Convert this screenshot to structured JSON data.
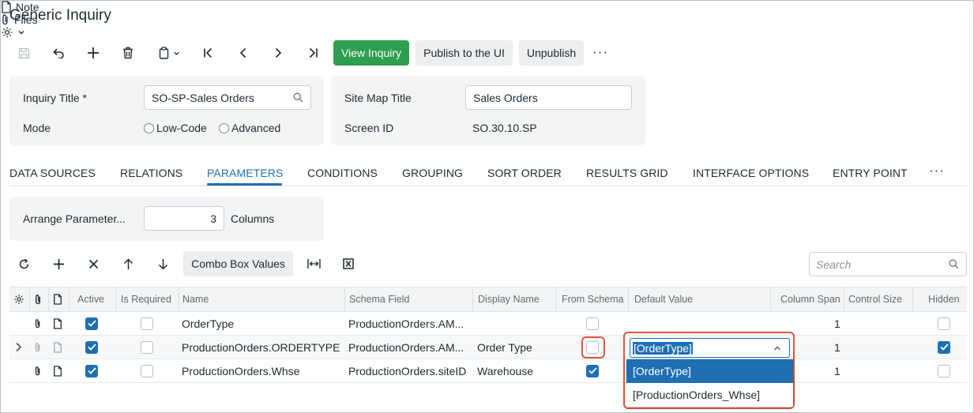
{
  "page": {
    "title": "Generic Inquiry",
    "actions": {
      "note": "Note",
      "files": "Files"
    }
  },
  "toolbar": {
    "view_inquiry": "View Inquiry",
    "publish": "Publish to the UI",
    "unpublish": "Unpublish",
    "more": "···"
  },
  "form": {
    "inquiry_title_label": "Inquiry Title *",
    "inquiry_title_value": "SO-SP-Sales Orders",
    "mode_label": "Mode",
    "mode_options": [
      "Low-Code",
      "Advanced"
    ],
    "site_map_title_label": "Site Map Title",
    "site_map_title_value": "Sales Orders",
    "screen_id_label": "Screen ID",
    "screen_id_value": "SO.30.10.SP"
  },
  "tabs": [
    "DATA SOURCES",
    "RELATIONS",
    "PARAMETERS",
    "CONDITIONS",
    "GROUPING",
    "SORT ORDER",
    "RESULTS GRID",
    "INTERFACE OPTIONS",
    "ENTRY POINT"
  ],
  "tabs_more": "···",
  "active_tab": "PARAMETERS",
  "arrange": {
    "label": "Arrange Parameter...",
    "value": "3",
    "suffix": "Columns"
  },
  "grid": {
    "combo_box_values": "Combo Box Values",
    "search_placeholder": "Search",
    "columns": [
      "Active",
      "Is Required",
      "Name",
      "Schema Field",
      "Display Name",
      "From Schema",
      "Default Value",
      "Column Span",
      "Control Size",
      "Hidden"
    ],
    "rows": [
      {
        "active": true,
        "is_required": false,
        "name": "OrderType",
        "schema_field": "ProductionOrders.AM...",
        "display_name": "",
        "from_schema": false,
        "default_value": "",
        "column_span": "1",
        "control_size": "",
        "hidden": false
      },
      {
        "active": true,
        "is_required": false,
        "name": "ProductionOrders.ORDERTYPE",
        "schema_field": "ProductionOrders.AM...",
        "display_name": "Order Type",
        "from_schema": false,
        "default_value": "[OrderType]",
        "column_span": "1",
        "control_size": "",
        "hidden": true
      },
      {
        "active": true,
        "is_required": false,
        "name": "ProductionOrders.Whse",
        "schema_field": "ProductionOrders.siteID",
        "display_name": "Warehouse",
        "from_schema": true,
        "default_value": "",
        "column_span": "1",
        "control_size": "",
        "hidden": false
      }
    ],
    "dropdown": {
      "input_value": "[OrderType]",
      "options": [
        "[OrderType]",
        "[ProductionOrders_Whse]"
      ]
    }
  },
  "icons": {
    "save": "save-icon",
    "undo": "undo-icon",
    "add": "plus-icon",
    "delete": "trash-icon",
    "copy": "copy-paste-icon",
    "first": "first-icon",
    "prev": "prev-icon",
    "next": "next-icon",
    "last": "last-icon",
    "refresh": "refresh-icon",
    "remove": "close-icon",
    "up": "arrow-up-icon",
    "down": "arrow-down-icon",
    "fit": "fit-width-icon",
    "excel": "excel-icon",
    "settings": "gear-icon",
    "attachment": "paperclip-icon",
    "note": "note-icon",
    "search": "search-icon"
  },
  "colors": {
    "primary": "#2e9e4f",
    "accent": "#1f6fb3",
    "highlight": "#e0533d"
  }
}
